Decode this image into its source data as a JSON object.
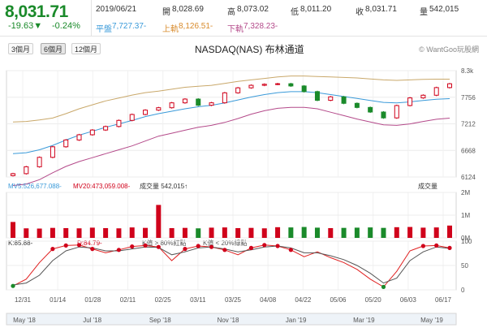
{
  "quote": {
    "price": "8,031.71",
    "change": "-19.63▼",
    "change_pct": "-0.24%",
    "date": "2019/06/21",
    "open_label": "開",
    "open": "8,028.69",
    "high_label": "高",
    "high": "8,073.02",
    "low_label": "低",
    "low": "8,011.20",
    "close_label": "收",
    "close": "8,031.71",
    "volume_label": "量",
    "volume": "542,015",
    "mid_label": "平盤",
    "mid": "7,727.37-",
    "upper_label": "上軌",
    "upper": "8,126.51-",
    "lower_label": "下軌",
    "lower": "7,328.23-"
  },
  "range_buttons": [
    {
      "label": "3個月",
      "active": false
    },
    {
      "label": "6個月",
      "active": true
    },
    {
      "label": "12個月",
      "active": false
    }
  ],
  "chart_title": "NASDAQ(NAS) 布林通道",
  "brand": "© WantGoo玩股網",
  "colors": {
    "up": "#d0021b",
    "down": "#1a8a2a",
    "upper_band": "#c9a86a",
    "mid_band": "#3a9ad9",
    "lower_band": "#b44a8a",
    "k_line": "#e02020",
    "d_line": "#555555",
    "volume_up": "#d0021b",
    "volume_down": "#1a8a2a"
  },
  "chart_data": [
    {
      "type": "line",
      "y_ticks": [
        "8.3k",
        "7756",
        "7212",
        "6668",
        "6124"
      ],
      "ylim": [
        6124,
        8300
      ],
      "x_ticks": [
        "12/31",
        "01/14",
        "01/28",
        "02/11",
        "02/25",
        "03/11",
        "03/25",
        "04/08",
        "04/22",
        "05/06",
        "05/20",
        "06/03",
        "06/17"
      ],
      "series": [
        {
          "role": "close",
          "values": [
            6192,
            6333,
            6526,
            6742,
            6881,
            6988,
            7085,
            7157,
            7282,
            7403,
            7492,
            7541,
            7641,
            7718,
            7592,
            7642,
            7846,
            7948,
            8000,
            8021,
            8032,
            7986,
            7871,
            7693,
            7764,
            7631,
            7547,
            7453,
            7333,
            7586,
            7742,
            7797,
            7953,
            8031
          ]
        },
        {
          "role": "upper_band",
          "values": [
            7250,
            7260,
            7290,
            7330,
            7420,
            7520,
            7600,
            7680,
            7740,
            7800,
            7850,
            7880,
            7920,
            7960,
            7980,
            8000,
            8040,
            8080,
            8110,
            8140,
            8170,
            8190,
            8190,
            8180,
            8170,
            8160,
            8150,
            8130,
            8110,
            8100,
            8110,
            8120,
            8125,
            8126
          ]
        },
        {
          "role": "mid_band",
          "values": [
            6600,
            6620,
            6680,
            6770,
            6880,
            6980,
            7060,
            7140,
            7210,
            7280,
            7360,
            7420,
            7470,
            7520,
            7560,
            7590,
            7640,
            7700,
            7760,
            7810,
            7850,
            7870,
            7870,
            7850,
            7810,
            7770,
            7730,
            7690,
            7650,
            7640,
            7660,
            7690,
            7715,
            7727
          ]
        },
        {
          "role": "lower_band",
          "values": [
            5950,
            5980,
            6070,
            6210,
            6340,
            6440,
            6520,
            6600,
            6680,
            6760,
            6860,
            6960,
            7020,
            7080,
            7140,
            7180,
            7240,
            7320,
            7410,
            7480,
            7530,
            7550,
            7550,
            7520,
            7450,
            7380,
            7310,
            7250,
            7190,
            7180,
            7210,
            7260,
            7305,
            7328
          ]
        }
      ]
    },
    {
      "type": "bar",
      "legend": [
        "MV5:526,677.088-",
        "MV20:473,059.008-",
        "成交量 542,015↑"
      ],
      "right_label": "成交量",
      "y_ticks": [
        "2M",
        "1M",
        "0M"
      ],
      "ylim": [
        0,
        2000000
      ],
      "values": [
        700000,
        420000,
        410000,
        440000,
        430000,
        420000,
        450000,
        430000,
        420000,
        460000,
        440000,
        1450000,
        430000,
        440000,
        420000,
        450000,
        460000,
        430000,
        440000,
        420000,
        470000,
        460000,
        480000,
        450000,
        430000,
        440000,
        450000,
        460000,
        440000,
        470000,
        480000,
        450000,
        460000,
        542015
      ]
    },
    {
      "type": "line",
      "legend": [
        "K:85.88-",
        "D:84.79-",
        "K值 > 80%紅點",
        "K值 < 20%綠點"
      ],
      "y_ticks": [
        "100",
        "50",
        "0"
      ],
      "ylim": [
        0,
        100
      ],
      "series": [
        {
          "role": "K",
          "values": [
            8,
            22,
            56,
            84,
            91,
            92,
            84,
            76,
            82,
            89,
            91,
            88,
            60,
            84,
            90,
            88,
            82,
            72,
            86,
            92,
            90,
            82,
            68,
            78,
            66,
            56,
            42,
            22,
            6,
            38,
            80,
            90,
            91,
            86
          ]
        },
        {
          "role": "D",
          "values": [
            10,
            14,
            30,
            60,
            80,
            88,
            86,
            80,
            80,
            84,
            88,
            87,
            72,
            78,
            86,
            88,
            84,
            78,
            82,
            88,
            90,
            86,
            76,
            76,
            70,
            62,
            50,
            34,
            14,
            24,
            60,
            78,
            88,
            85
          ]
        }
      ]
    }
  ],
  "bottom_axis": [
    "May '18",
    "Jul '18",
    "Sep '18",
    "Nov '18",
    "Jan '19",
    "Mar '19",
    "May '19"
  ]
}
